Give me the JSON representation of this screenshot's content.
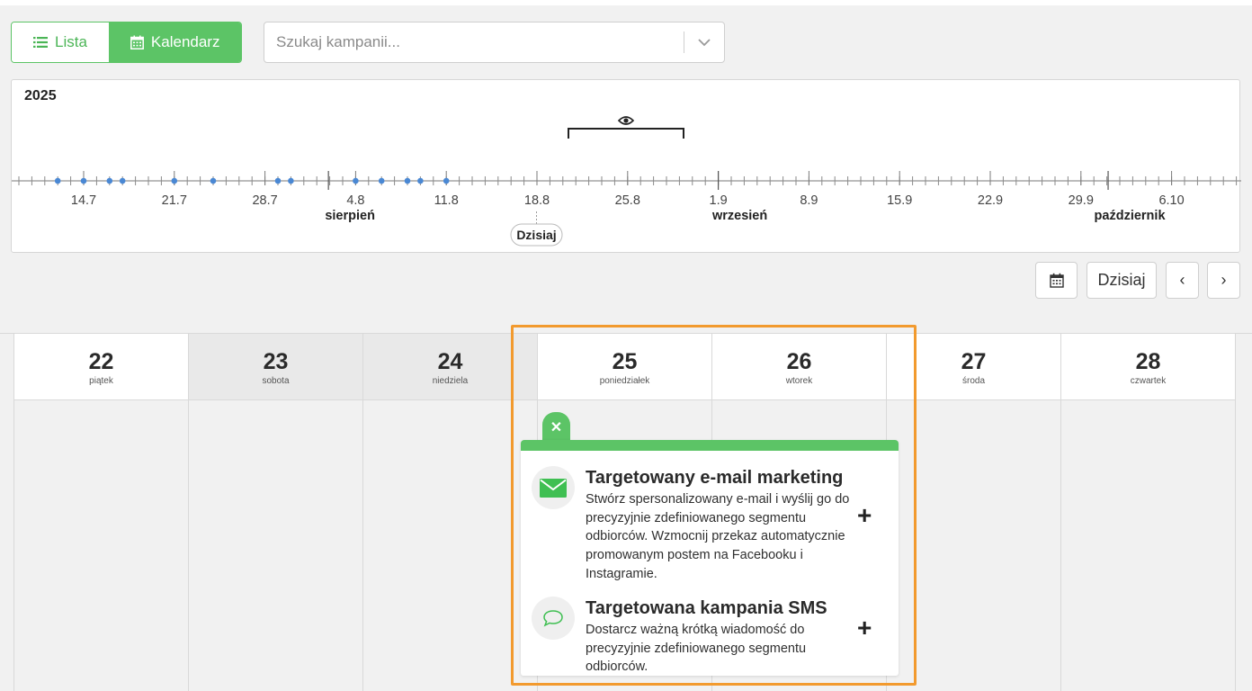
{
  "view_toggle": {
    "list_label": "Lista",
    "calendar_label": "Kalendarz",
    "active": "calendar"
  },
  "search": {
    "placeholder": "Szukaj kampanii..."
  },
  "timeline": {
    "year": "2025",
    "date_labels": [
      "14.7",
      "21.7",
      "28.7",
      "4.8",
      "11.8",
      "18.8",
      "25.8",
      "1.9",
      "8.9",
      "15.9",
      "22.9",
      "29.9",
      "6.10"
    ],
    "month_labels": [
      "sierpień",
      "wrzesień",
      "październik"
    ],
    "today_label": "Dzisiaj"
  },
  "calendar_toolbar": {
    "today_label": "Dzisiaj",
    "prev_glyph": "‹",
    "next_glyph": "›"
  },
  "days": [
    {
      "num": "22",
      "name": "piątek",
      "weekend": false
    },
    {
      "num": "23",
      "name": "sobota",
      "weekend": true
    },
    {
      "num": "24",
      "name": "niedziela",
      "weekend": true
    },
    {
      "num": "25",
      "name": "poniedziałek",
      "weekend": false
    },
    {
      "num": "26",
      "name": "wtorek",
      "weekend": false
    },
    {
      "num": "27",
      "name": "środa",
      "weekend": false
    },
    {
      "num": "28",
      "name": "czwartek",
      "weekend": false
    }
  ],
  "popup": {
    "close_glyph": "✕",
    "options": [
      {
        "icon": "envelope-icon",
        "title": "Targetowany e-mail marketing",
        "description": "Stwórz spersonalizowany e-mail i wyślij go do precyzyjnie zdefiniowanego segmentu odbiorców. Wzmocnij przekaz automatycznie promowanym postem na Facebooku i Instagramie.",
        "add_glyph": "+"
      },
      {
        "icon": "speech-bubble-icon",
        "title": "Targetowana kampania SMS",
        "description": "Dostarcz ważną krótką wiadomość do precyzyjnie zdefiniowanego segmentu odbiorców.",
        "add_glyph": "+"
      }
    ]
  },
  "colors": {
    "accent_green": "#5cc466",
    "timeline_dot": "#4a88d4",
    "highlight_orange": "#f29a2e"
  }
}
